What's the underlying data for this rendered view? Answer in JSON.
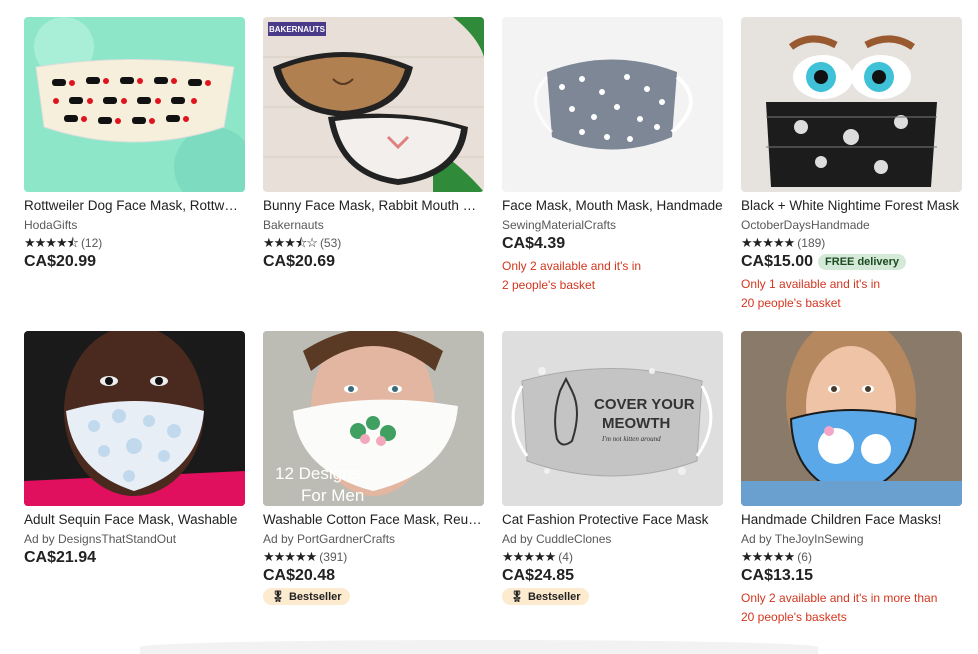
{
  "listings": [
    {
      "title": "Rottweiler Dog Face Mask, Rottweiler Print",
      "shop": "HodaGifts",
      "stars": "★★★★⯪",
      "rating_count": "(12)",
      "price": "CA$20.99"
    },
    {
      "title": "Bunny Face Mask, Rabbit Mouth Mask",
      "shop": "Bakernauts",
      "stars": "★★★⯪☆",
      "rating_count": "(53)",
      "price": "CA$20.69",
      "image_label": "BAKERNAUTS"
    },
    {
      "title": "Face Mask, Mouth Mask, Handmade",
      "shop": "SewingMaterialCrafts",
      "price": "CA$4.39",
      "stock": "Only 2 available and it's in\n2 people's basket"
    },
    {
      "title": "Black + White Nightime Forest Mask",
      "shop": "OctoberDaysHandmade",
      "stars": "★★★★★",
      "rating_count": "(189)",
      "price": "CA$15.00",
      "free_delivery": "FREE delivery",
      "stock": "Only 1 available and it's in\n20 people's basket"
    },
    {
      "title": "Adult Sequin Face Mask, Washable",
      "shop": "Ad by DesignsThatStandOut",
      "price": "CA$21.94"
    },
    {
      "title": "Washable Cotton Face Mask, Reusable",
      "shop": "Ad by PortGardnerCrafts",
      "stars": "★★★★★",
      "rating_count": "(391)",
      "price": "CA$20.48",
      "badge": "Bestseller",
      "image_label": "12 Designs\nFor Men"
    },
    {
      "title": "Cat Fashion Protective Face Mask",
      "shop": "Ad by CuddleClones",
      "stars": "★★★★★",
      "rating_count": "(4)",
      "price": "CA$24.85",
      "badge": "Bestseller",
      "image_label": "COVER YOUR\nMEOWTH",
      "image_sublabel": "I'm not kitten around"
    },
    {
      "title": "Handmade Children Face Masks!",
      "shop": "Ad by TheJoyInSewing",
      "stars": "★★★★★",
      "rating_count": "(6)",
      "price": "CA$13.15",
      "stock": "Only 2 available and it's in more than\n20 people's baskets"
    }
  ],
  "colors": {
    "price": "#222222",
    "stock": "#d3361f",
    "free_bg": "#d4e9d7",
    "badge_bg": "#fdebd0"
  }
}
